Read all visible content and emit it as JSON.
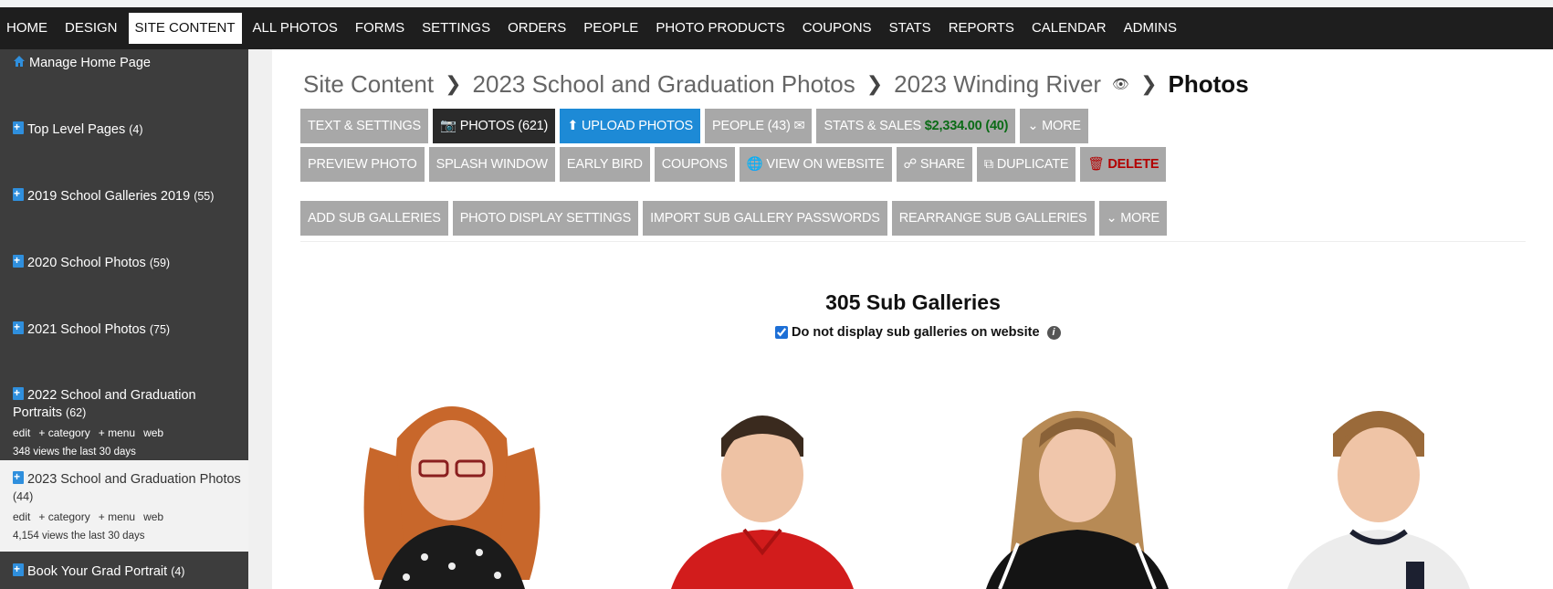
{
  "nav": {
    "items": [
      "HOME",
      "DESIGN",
      "SITE CONTENT",
      "ALL PHOTOS",
      "FORMS",
      "SETTINGS",
      "ORDERS",
      "PEOPLE",
      "PHOTO PRODUCTS",
      "COUPONS",
      "STATS",
      "REPORTS",
      "CALENDAR",
      "ADMINS"
    ],
    "active": "SITE CONTENT"
  },
  "sidebar": {
    "home": "Manage Home Page",
    "items": [
      {
        "label": "Top Level Pages",
        "count": "(4)"
      },
      {
        "label": "2019 School Galleries 2019",
        "count": "(55)"
      },
      {
        "label": "2020 School Photos",
        "count": "(59)"
      },
      {
        "label": "2021 School Photos",
        "count": "(75)"
      },
      {
        "label": "2022 School and Graduation Portraits",
        "count": "(62)",
        "links": [
          "edit",
          "+ category",
          "+ menu",
          "web"
        ],
        "views": "348 views the last 30 days"
      },
      {
        "label": "2023 School and Graduation Photos",
        "count": "(44)",
        "links": [
          "edit",
          "+ category",
          "+ menu",
          "web"
        ],
        "views": "4,154 views the last 30 days"
      },
      {
        "label": "Book Your Grad Portrait",
        "count": "(4)"
      }
    ]
  },
  "breadcrumb": {
    "crumb1": "Site Content",
    "crumb2": "2023 School and Graduation Photos",
    "crumb3": "2023 Winding River",
    "current": "Photos"
  },
  "buttons": {
    "row1": {
      "text_settings": "TEXT & SETTINGS",
      "photos": "PHOTOS (621)",
      "upload": "UPLOAD PHOTOS",
      "people": "PEOPLE (43)",
      "stats_label": "STATS & SALES",
      "stats_value": "$2,334.00 (40)",
      "more": "MORE"
    },
    "row2": {
      "preview": "PREVIEW PHOTO",
      "splash": "SPLASH WINDOW",
      "early_bird": "EARLY BIRD",
      "coupons": "COUPONS",
      "view_site": "VIEW ON WEBSITE",
      "share": "SHARE",
      "duplicate": "DUPLICATE",
      "delete": "DELETE"
    },
    "row3": {
      "add_sub": "ADD SUB GALLERIES",
      "display_settings": "PHOTO DISPLAY SETTINGS",
      "import_passwords": "IMPORT SUB GALLERY PASSWORDS",
      "rearrange": "REARRANGE SUB GALLERIES",
      "more": "MORE"
    }
  },
  "galleries": {
    "title": "305 Sub Galleries",
    "hide_label": "Do not display sub galleries on website",
    "hide_checked": true
  },
  "colors": {
    "nav_bg": "#1e1e1e",
    "sidebar_bg": "#3d3d3d",
    "button_gray": "#a8a8a8",
    "button_blue": "#1d8ad6",
    "sales_green": "#0b6b16",
    "delete_red": "#b30000"
  }
}
